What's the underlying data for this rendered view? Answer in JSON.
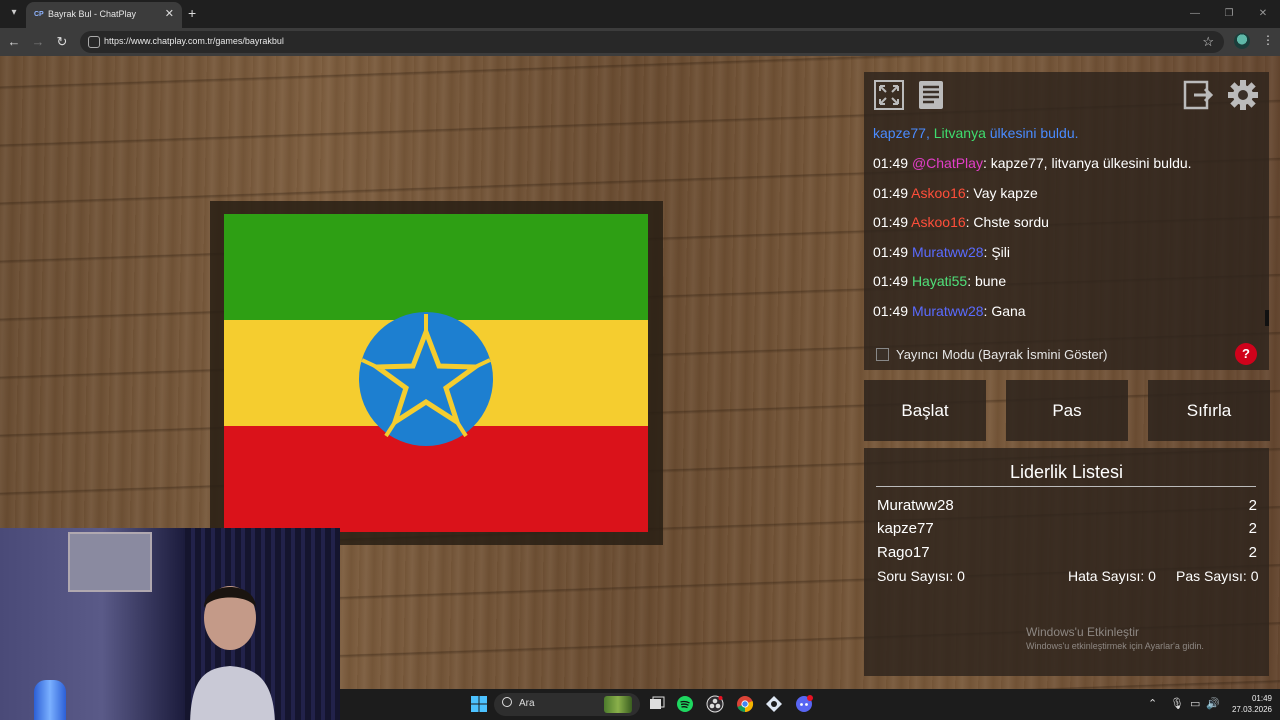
{
  "browser": {
    "tab_title": "Bayrak Bul - ChatPlay",
    "tab_favicon": "CP",
    "url": "https://www.chatplay.com.tr/games/bayrakbul"
  },
  "flag": {
    "country": "Ethiopia",
    "colors": {
      "green": "#2e9f14",
      "yellow": "#f5cd2f",
      "red": "#da121a",
      "blue": "#1d7fd0"
    }
  },
  "chat": {
    "icons": [
      "fullscreen-icon",
      "notes-icon",
      "logout-icon",
      "settings-icon"
    ],
    "messages": [
      {
        "time": "",
        "user": "kapze77",
        "user_color": "#4a8bff",
        "sep": ", ",
        "text": "Litvanya",
        "text_color": "#3fdc6e",
        "rest": " ülkesini buldu.",
        "rest_color": "#4a8bff"
      },
      {
        "time": "01:49",
        "user": "@ChatPlay",
        "user_color": "#e23ec8",
        "sep": ": ",
        "text": "kapze77, litvanya ülkesini buldu.",
        "text_color": "#ffffff",
        "rest": "",
        "rest_color": "#ffffff"
      },
      {
        "time": "01:49",
        "user": "Askoo16",
        "user_color": "#ff4e3a",
        "sep": ": ",
        "text": "Vay kapze",
        "text_color": "#ffffff",
        "rest": "",
        "rest_color": "#ffffff"
      },
      {
        "time": "01:49",
        "user": "Askoo16",
        "user_color": "#ff4e3a",
        "sep": ": ",
        "text": "Chste sordu",
        "text_color": "#ffffff",
        "rest": "",
        "rest_color": "#ffffff"
      },
      {
        "time": "01:49",
        "user": "Muratww28",
        "user_color": "#5a6bff",
        "sep": ": ",
        "text": "Şili",
        "text_color": "#ffffff",
        "rest": "",
        "rest_color": "#ffffff"
      },
      {
        "time": "01:49",
        "user": "Hayati55",
        "user_color": "#4fe07a",
        "sep": ": ",
        "text": "bune",
        "text_color": "#ffffff",
        "rest": "",
        "rest_color": "#ffffff"
      },
      {
        "time": "01:49",
        "user": "Muratww28",
        "user_color": "#5a6bff",
        "sep": ": ",
        "text": "Gana",
        "text_color": "#ffffff",
        "rest": "",
        "rest_color": "#ffffff"
      }
    ],
    "streamer_mode_label": "Yayıncı Modu (Bayrak İsmini Göster)",
    "streamer_mode_checked": false,
    "help_label": "?"
  },
  "actions": {
    "start": "Başlat",
    "pass": "Pas",
    "reset": "Sıfırla"
  },
  "leaderboard": {
    "title": "Liderlik Listesi",
    "rows": [
      {
        "name": "Muratww28",
        "score": "2"
      },
      {
        "name": "kapze77",
        "score": "2"
      },
      {
        "name": "Rago17",
        "score": "2"
      }
    ],
    "stats": {
      "questions_label": "Soru Sayısı:",
      "questions": "0",
      "errors_label": "Hata Sayısı:",
      "errors": "0",
      "passes_label": "Pas Sayısı:",
      "passes": "0"
    }
  },
  "windows_activation": {
    "title": "Windows'u Etkinleştir",
    "subtitle": "Windows'u etkinleştirmek için Ayarlar'a gidin."
  },
  "taskbar": {
    "search_placeholder": "Ara",
    "clock_time": "01:49",
    "clock_date": "27.03.2026"
  }
}
